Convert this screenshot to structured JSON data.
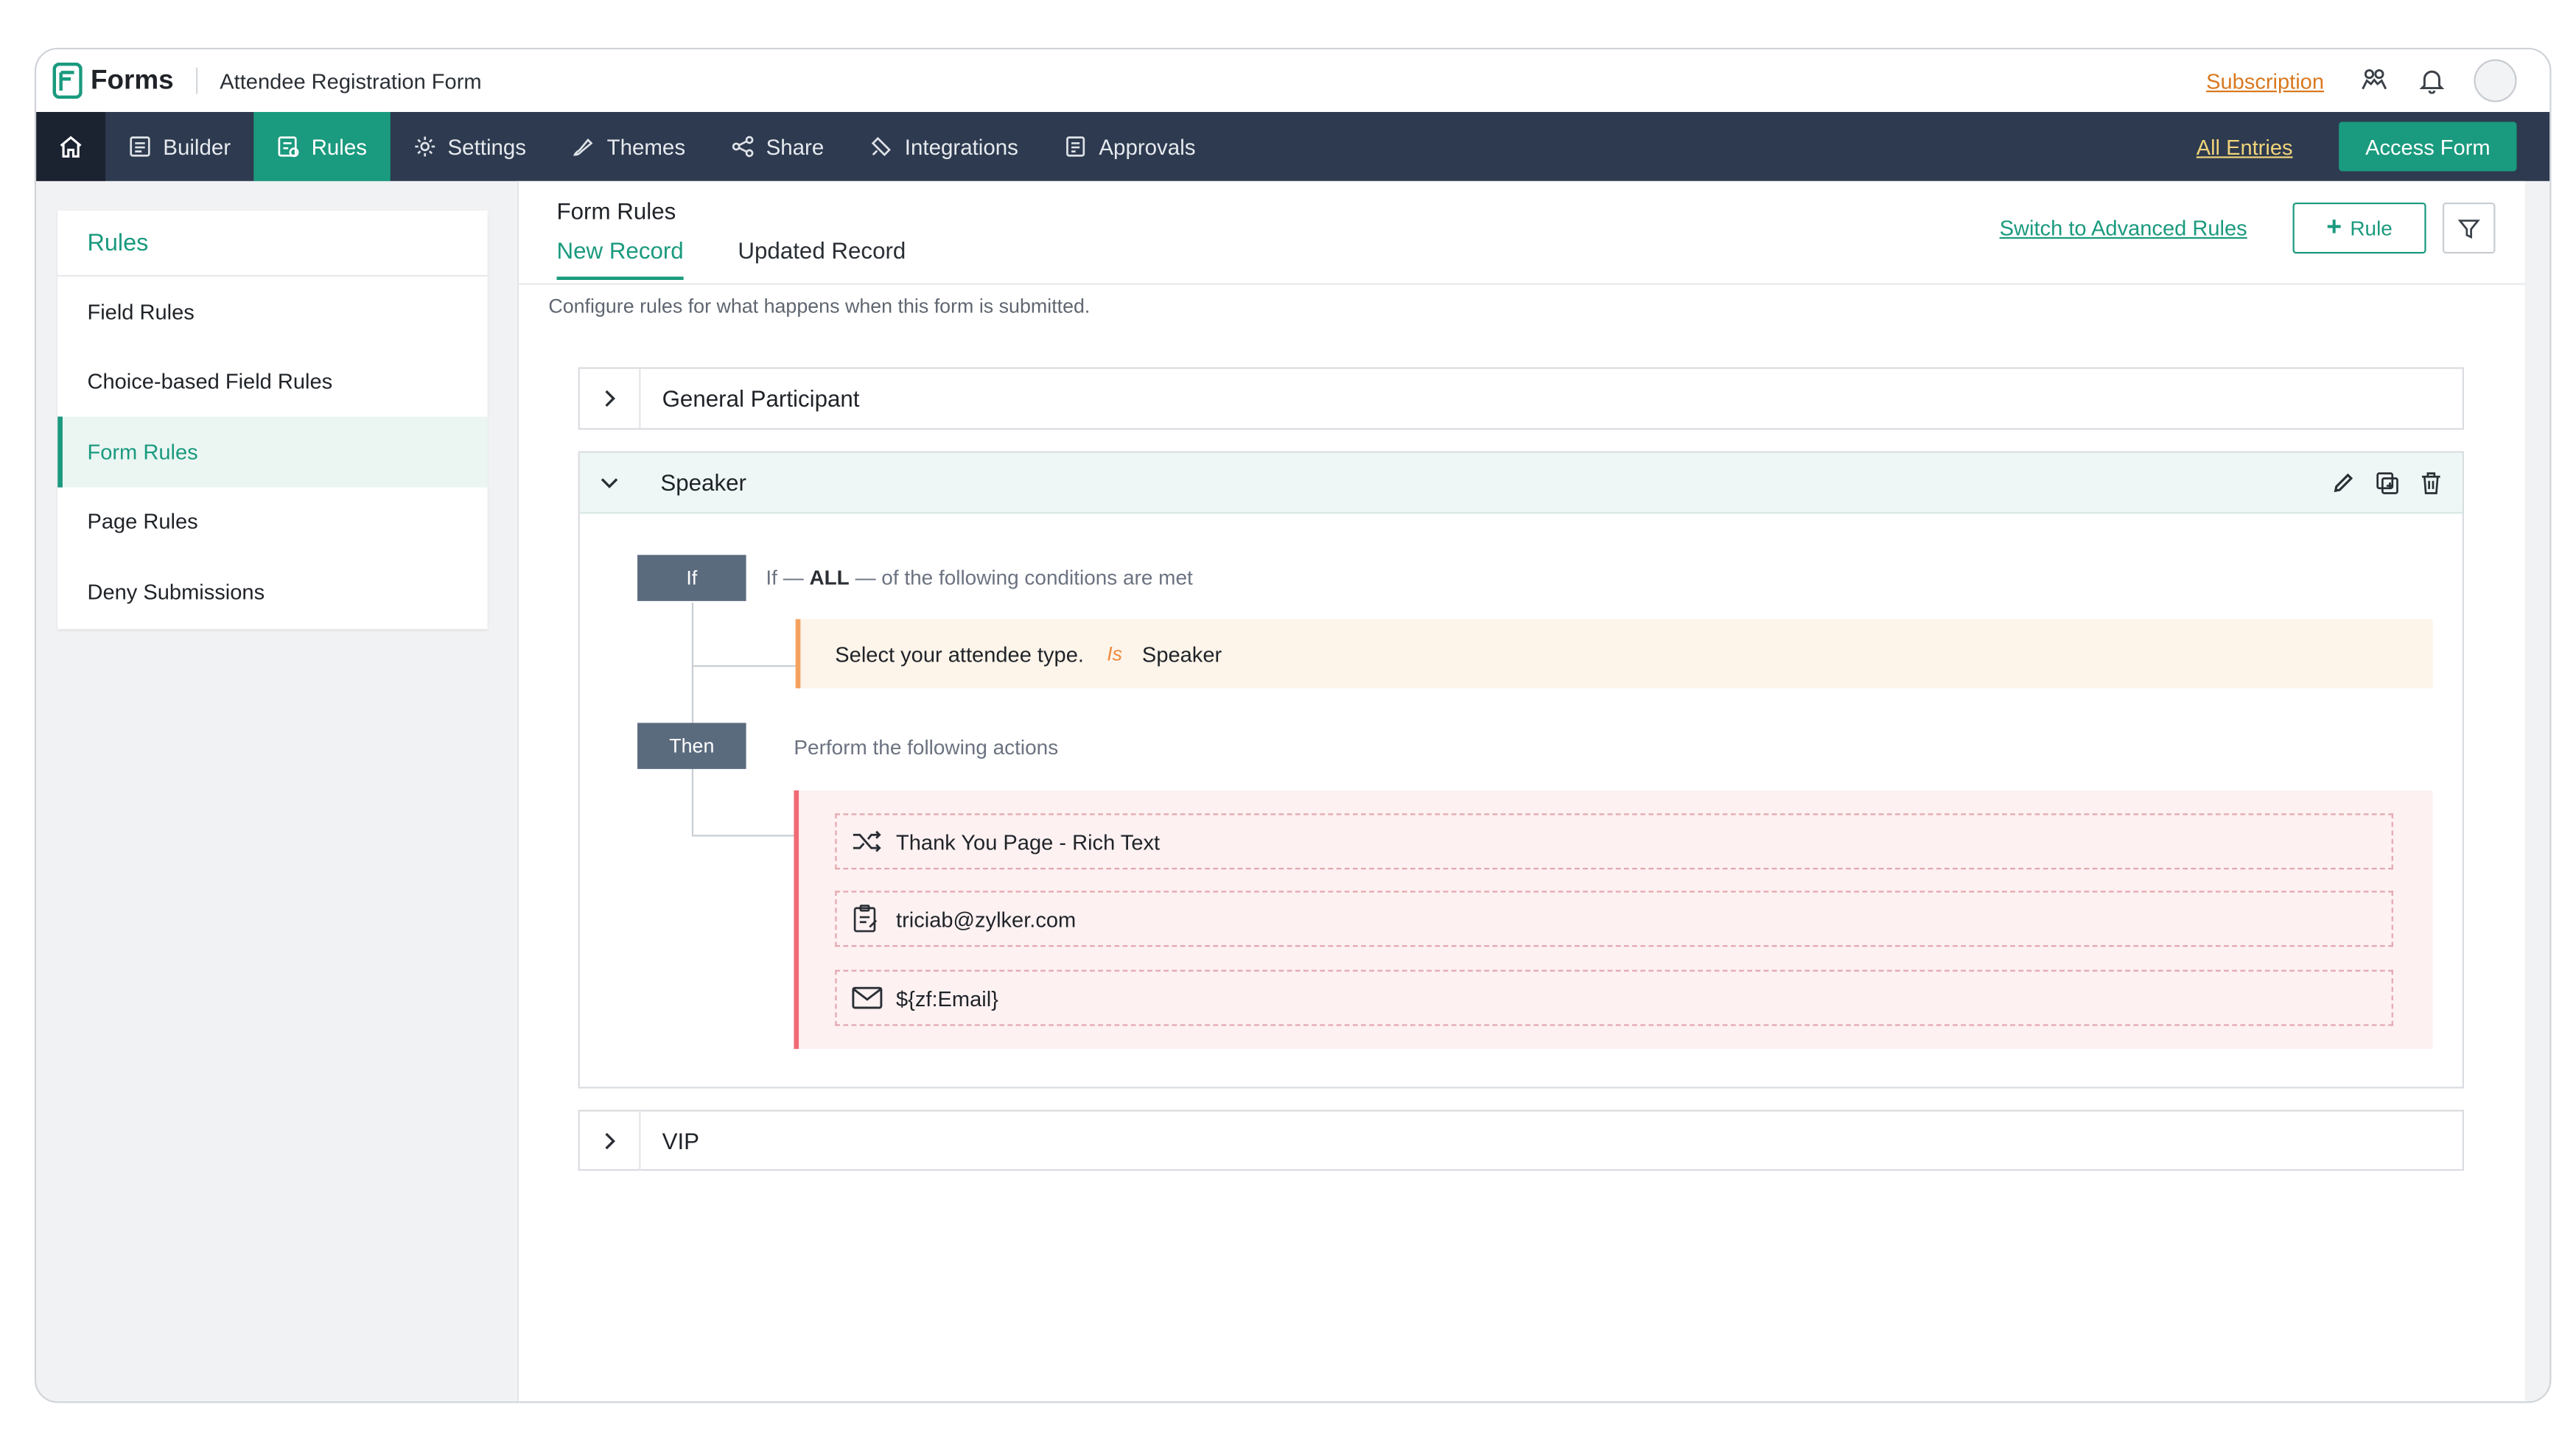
{
  "app": {
    "name": "Forms",
    "form_title": "Attendee Registration Form"
  },
  "top_bar": {
    "subscription_label": "Subscription"
  },
  "nav": {
    "items": [
      {
        "label": "Builder",
        "icon": "builder-icon"
      },
      {
        "label": "Rules",
        "icon": "rules-icon",
        "active": true
      },
      {
        "label": "Settings",
        "icon": "gear-icon"
      },
      {
        "label": "Themes",
        "icon": "brush-icon"
      },
      {
        "label": "Share",
        "icon": "share-icon"
      },
      {
        "label": "Integrations",
        "icon": "plug-icon"
      },
      {
        "label": "Approvals",
        "icon": "approval-icon"
      }
    ],
    "all_entries_label": "All Entries",
    "access_form_label": "Access Form"
  },
  "sidebar": {
    "title": "Rules",
    "items": [
      {
        "label": "Field Rules"
      },
      {
        "label": "Choice-based Field Rules"
      },
      {
        "label": "Form Rules",
        "active": true
      },
      {
        "label": "Page Rules"
      },
      {
        "label": "Deny Submissions"
      }
    ]
  },
  "main": {
    "heading": "Form Rules",
    "tabs": [
      {
        "label": "New Record",
        "active": true
      },
      {
        "label": "Updated Record"
      }
    ],
    "advanced_link": "Switch to Advanced Rules",
    "add_rule_label": "Rule",
    "description": "Configure rules for what happens when this form is submitted."
  },
  "rules": {
    "general": {
      "name": "General Participant",
      "expanded": false
    },
    "speaker": {
      "name": "Speaker",
      "expanded": true,
      "if_label": "If",
      "cond_prefix": "If —",
      "cond_quantifier": "ALL",
      "cond_suffix": "— of the following conditions are met",
      "condition": {
        "field": "Select your attendee type.",
        "operator": "Is",
        "value": "Speaker"
      },
      "then_label": "Then",
      "actions_intro": "Perform the following actions",
      "actions": [
        {
          "icon": "shuffle-icon",
          "text": "Thank You Page - Rich Text"
        },
        {
          "icon": "clipboard-icon",
          "text": "triciab@zylker.com"
        },
        {
          "icon": "mail-icon",
          "text": "${zf:Email}"
        }
      ]
    },
    "vip": {
      "name": "VIP",
      "expanded": false
    }
  },
  "colors": {
    "accent": "#1a9a7e",
    "nav_bg": "#2d3a4f",
    "subscription": "#d9791f",
    "entries_link": "#f0d37a"
  }
}
